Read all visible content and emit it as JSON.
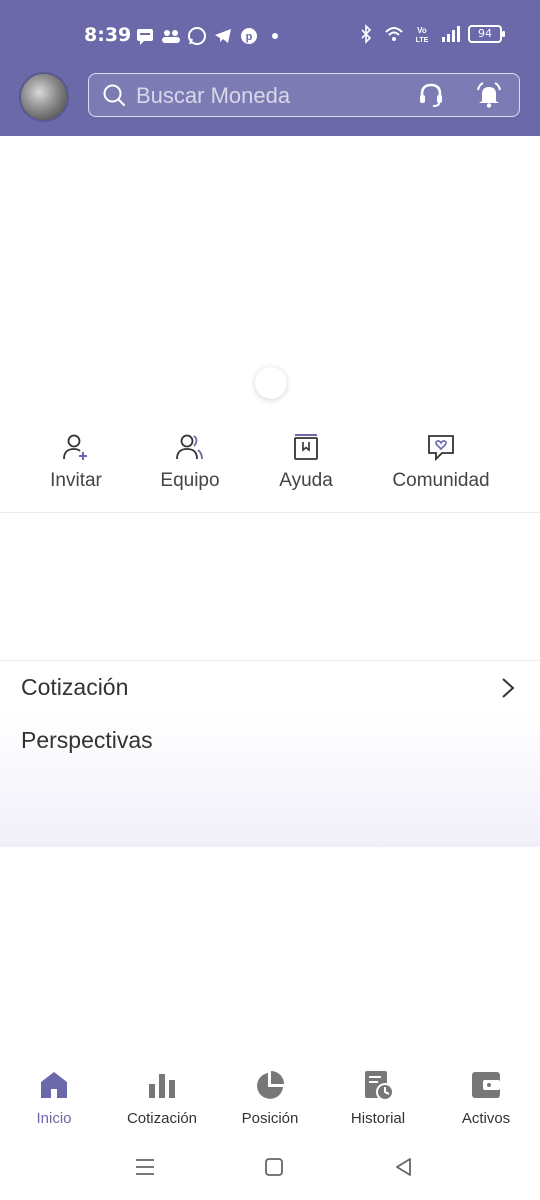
{
  "status_bar": {
    "time": "8:39",
    "battery": "94",
    "left_icons": [
      "message-icon",
      "group-icon",
      "whatsapp-icon",
      "telegram-icon",
      "pinterest-icon",
      "dot-icon"
    ],
    "right_icons": [
      "bluetooth-icon",
      "wifi-icon",
      "volte-icon",
      "signal-icon",
      "battery-icon"
    ]
  },
  "header": {
    "search_placeholder": "Buscar Moneda",
    "accent_color": "#6b69aa"
  },
  "shortcuts": [
    {
      "label": "Invitar",
      "icon": "invite-user-icon"
    },
    {
      "label": "Equipo",
      "icon": "team-icon"
    },
    {
      "label": "Ayuda",
      "icon": "help-book-icon"
    },
    {
      "label": "Comunidad",
      "icon": "community-chat-icon"
    }
  ],
  "sections": {
    "cotizacion": "Cotización",
    "perspectivas": "Perspectivas"
  },
  "bottom_nav": [
    {
      "label": "Inicio",
      "icon": "home-icon",
      "active": true
    },
    {
      "label": "Cotización",
      "icon": "bar-chart-icon",
      "active": false
    },
    {
      "label": "Posición",
      "icon": "pie-chart-icon",
      "active": false
    },
    {
      "label": "Historial",
      "icon": "history-icon",
      "active": false
    },
    {
      "label": "Activos",
      "icon": "wallet-icon",
      "active": false
    }
  ]
}
